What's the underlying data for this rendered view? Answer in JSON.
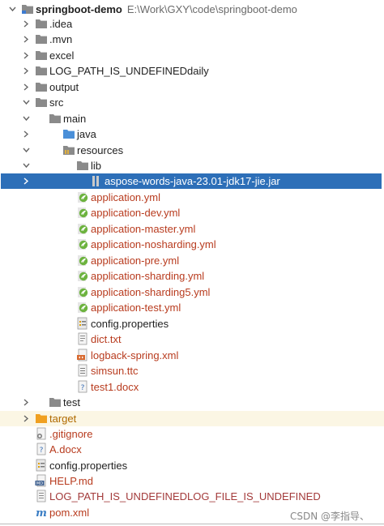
{
  "project": {
    "name": "springboot-demo",
    "path": "E:\\Work\\GXY\\code\\springboot-demo"
  },
  "rows": [
    {
      "label": "springboot-demo",
      "icon": "module-folder-icon",
      "chevron": "down",
      "color": "dark",
      "bold": true,
      "path": "E:\\Work\\GXY\\code\\springboot-demo"
    },
    {
      "label": ".idea",
      "icon": "folder-icon",
      "chevron": "right",
      "color": "dark"
    },
    {
      "label": ".mvn",
      "icon": "folder-icon",
      "chevron": "right",
      "color": "dark"
    },
    {
      "label": "excel",
      "icon": "folder-icon",
      "chevron": "right",
      "color": "dark"
    },
    {
      "label": "LOG_PATH_IS_UNDEFINEDdaily",
      "icon": "folder-icon",
      "chevron": "right",
      "color": "dark"
    },
    {
      "label": "output",
      "icon": "folder-icon",
      "chevron": "right",
      "color": "dark"
    },
    {
      "label": "src",
      "icon": "folder-icon",
      "chevron": "down",
      "color": "dark"
    },
    {
      "label": "main",
      "icon": "folder-icon",
      "chevron": "down",
      "color": "dark"
    },
    {
      "label": "java",
      "icon": "source-folder-icon",
      "chevron": "right",
      "color": "dark"
    },
    {
      "label": "resources",
      "icon": "resources-folder-icon",
      "chevron": "down",
      "color": "dark"
    },
    {
      "label": "lib",
      "icon": "folder-icon",
      "chevron": "down",
      "color": "dark"
    },
    {
      "label": "aspose-words-java-23.01-jdk17-jie.jar",
      "icon": "jar-icon",
      "chevron": "right",
      "color": "white",
      "selected": true
    },
    {
      "label": "application.yml",
      "icon": "spring-yaml-icon",
      "color": "red"
    },
    {
      "label": "application-dev.yml",
      "icon": "spring-yaml-icon",
      "color": "red"
    },
    {
      "label": "application-master.yml",
      "icon": "spring-yaml-icon",
      "color": "red"
    },
    {
      "label": "application-nosharding.yml",
      "icon": "spring-yaml-icon",
      "color": "red"
    },
    {
      "label": "application-pre.yml",
      "icon": "spring-yaml-icon",
      "color": "red"
    },
    {
      "label": "application-sharding.yml",
      "icon": "spring-yaml-icon",
      "color": "red"
    },
    {
      "label": "application-sharding5.yml",
      "icon": "spring-yaml-icon",
      "color": "red"
    },
    {
      "label": "application-test.yml",
      "icon": "spring-yaml-icon",
      "color": "red"
    },
    {
      "label": "config.properties",
      "icon": "properties-icon",
      "color": "dark"
    },
    {
      "label": "dict.txt",
      "icon": "text-file-icon",
      "color": "red"
    },
    {
      "label": "logback-spring.xml",
      "icon": "xml-icon",
      "color": "red"
    },
    {
      "label": "simsun.ttc",
      "icon": "font-file-icon",
      "color": "red"
    },
    {
      "label": "test1.docx",
      "icon": "unknown-file-icon",
      "color": "red"
    },
    {
      "label": "test",
      "icon": "folder-icon",
      "chevron": "right",
      "color": "dark"
    },
    {
      "label": "target",
      "icon": "excluded-folder-icon",
      "chevron": "right",
      "color": "orange",
      "shade": true
    },
    {
      "label": ".gitignore",
      "icon": "gitignore-icon",
      "color": "red"
    },
    {
      "label": "A.docx",
      "icon": "unknown-file-icon",
      "color": "red"
    },
    {
      "label": "config.properties",
      "icon": "properties-icon",
      "color": "dark"
    },
    {
      "label": "HELP.md",
      "icon": "markdown-icon",
      "color": "red"
    },
    {
      "label": "LOG_PATH_IS_UNDEFINEDLOG_FILE_IS_UNDEFINED",
      "icon": "log-file-icon",
      "color": "excluded"
    },
    {
      "label": "pom.xml",
      "icon": "maven-icon",
      "color": "red"
    }
  ],
  "watermark": "CSDN @李指导、",
  "colors": {
    "selection": "#2d6fb8",
    "unversioned": "#b83b1e",
    "folder": "#8a8a8a",
    "target_folder": "#f0a020",
    "spring_green": "#6db33f"
  }
}
